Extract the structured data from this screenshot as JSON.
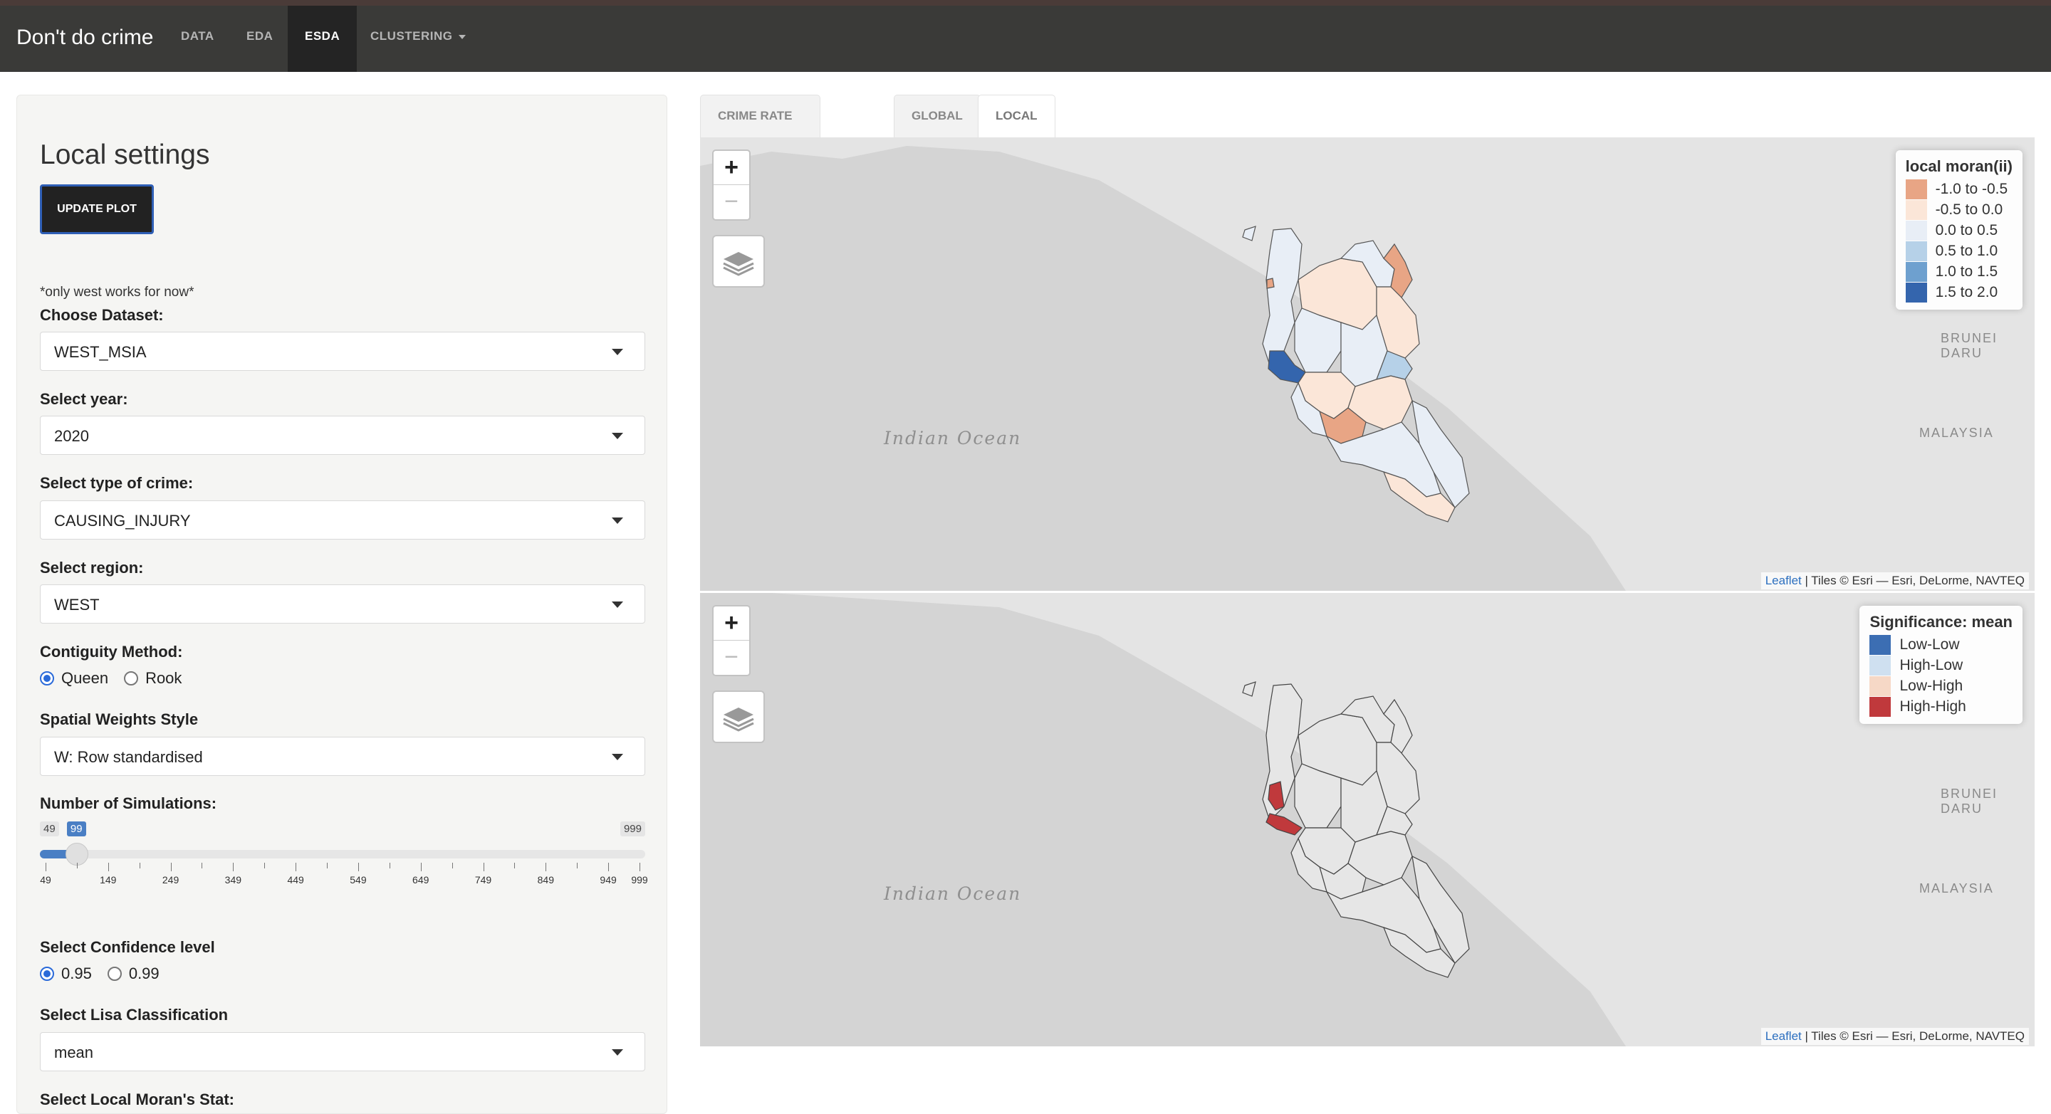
{
  "navbar": {
    "brand": "Don't do crime",
    "items": [
      {
        "label": "DATA"
      },
      {
        "label": "EDA"
      },
      {
        "label": "ESDA"
      },
      {
        "label": "CLUSTERING"
      }
    ],
    "active": "ESDA"
  },
  "sidebar": {
    "title": "Local settings",
    "update_button": "UPDATE PLOT",
    "note": "*only west works for now*",
    "dataset": {
      "label": "Choose Dataset:",
      "value": "WEST_MSIA"
    },
    "year": {
      "label": "Select year:",
      "value": "2020"
    },
    "crime": {
      "label": "Select type of crime:",
      "value": "CAUSING_INJURY"
    },
    "region": {
      "label": "Select region:",
      "value": "WEST"
    },
    "contiguity": {
      "label": "Contiguity Method:",
      "options": [
        "Queen",
        "Rook"
      ],
      "selected": "Queen"
    },
    "weights": {
      "label": "Spatial Weights Style",
      "value": "W: Row standardised"
    },
    "simulations": {
      "label": "Number of Simulations:",
      "min": "49",
      "max": "999",
      "value": "99",
      "tick_labels": [
        "49",
        "149",
        "249",
        "349",
        "449",
        "549",
        "649",
        "749",
        "849",
        "949",
        "999"
      ]
    },
    "confidence": {
      "label": "Select Confidence level",
      "options": [
        "0.95",
        "0.99"
      ],
      "selected": "0.95"
    },
    "lisa": {
      "label": "Select Lisa Classification",
      "value": "mean"
    },
    "local_moran": {
      "label": "Select Local Moran's Stat:"
    }
  },
  "tabs": [
    {
      "label": "CRIME RATE CHOROPLETH"
    },
    {
      "label": "GLOBAL"
    },
    {
      "label": "LOCAL"
    }
  ],
  "active_tab": "LOCAL",
  "map_top": {
    "legend_title": "local moran(ii)",
    "legend_items": [
      {
        "label": "-1.0 to -0.5",
        "color": "#e8a585"
      },
      {
        "label": "-0.5 to 0.0",
        "color": "#fbe6d8"
      },
      {
        "label": "0.0 to 0.5",
        "color": "#e8eef6"
      },
      {
        "label": "0.5 to 1.0",
        "color": "#b6d1e8"
      },
      {
        "label": "1.0 to 1.5",
        "color": "#6ea0cf"
      },
      {
        "label": "1.5 to 2.0",
        "color": "#3465ad"
      }
    ],
    "zoom_in": "+",
    "zoom_out": "−"
  },
  "map_bottom": {
    "legend_title": "Significance: mean",
    "legend_items": [
      {
        "label": "Low-Low",
        "color": "#3c6eb3"
      },
      {
        "label": "High-Low",
        "color": "#cfe0f0"
      },
      {
        "label": "Low-High",
        "color": "#f6d8c6"
      },
      {
        "label": "High-High",
        "color": "#c0393c"
      }
    ],
    "zoom_in": "+",
    "zoom_out": "−"
  },
  "map_labels": {
    "ocean": "Indian Ocean",
    "malaysia": "MALAYSIA",
    "brunei": "BRUNEI DARU"
  },
  "attribution": {
    "link": "Leaflet",
    "text": " | Tiles © Esri — Esri, DeLorme, NAVTEQ"
  }
}
